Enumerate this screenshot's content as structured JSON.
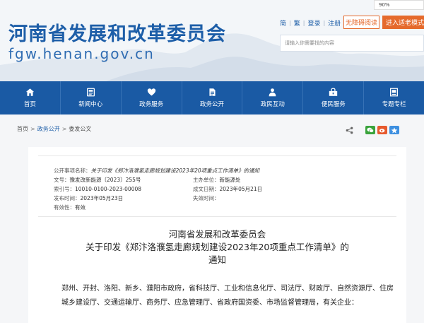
{
  "header": {
    "site_title": "河南省发展和改革委员会",
    "site_domain": "fgw.henan.gov.cn",
    "lang_simplified": "简",
    "lang_traditional": "繁",
    "login": "登录",
    "register": "注册",
    "accessible_label": "无障碍阅读",
    "elder_mode_label": "进入适老模式",
    "search_placeholder": "请输入你需要找的内容",
    "zoom_popup": "90%"
  },
  "nav": {
    "items": [
      {
        "label": "首页",
        "icon": "home-icon"
      },
      {
        "label": "新闻中心",
        "icon": "news-icon"
      },
      {
        "label": "政务服务",
        "icon": "service-icon"
      },
      {
        "label": "政务公开",
        "icon": "open-icon"
      },
      {
        "label": "政民互动",
        "icon": "interaction-icon"
      },
      {
        "label": "便民服务",
        "icon": "convenience-icon"
      },
      {
        "label": "专题专栏",
        "icon": "topic-icon"
      }
    ]
  },
  "breadcrumb": {
    "home": "首页",
    "level1": "政务公开",
    "level2": "委发公文",
    "separator": ">"
  },
  "meta": {
    "subject_label": "公开事项名称：",
    "subject_value": "关于印发《郑汴洛濮氢走廊规划建设2023年20项重点工作清单》的通知",
    "doc_no_label": "文号：",
    "doc_no_value": "豫发改新能源〔2023〕255号",
    "dept_label": "主办单位：",
    "dept_value": "新能源处",
    "index_label": "索引号：",
    "index_value": "10010-0100-2023-00008",
    "created_label": "成文日期：",
    "created_value": "2023年05月21日",
    "published_label": "发布时间：",
    "published_value": "2023年05月23日",
    "expire_label": "失效时间：",
    "expire_value": "",
    "validity_label": "有效性：",
    "validity_value": "有效"
  },
  "document": {
    "issuer": "河南省发展和改革委员会",
    "title_line1": "关于印发《郑汴洛濮氢走廊规划建设2023年20项重点工作清单》的",
    "title_line2": "通知",
    "body": "郑州、开封、洛阳、新乡、濮阳市政府，省科技厅、工业和信息化厅、司法厅、财政厅、自然资源厅、住房城乡建设厅、交通运输厅、商务厅、应急管理厅、省政府国资委、市场监督管理局，有关企业："
  },
  "colors": {
    "brand_blue": "#1a5aa4",
    "accent_orange": "#e56a2c"
  }
}
